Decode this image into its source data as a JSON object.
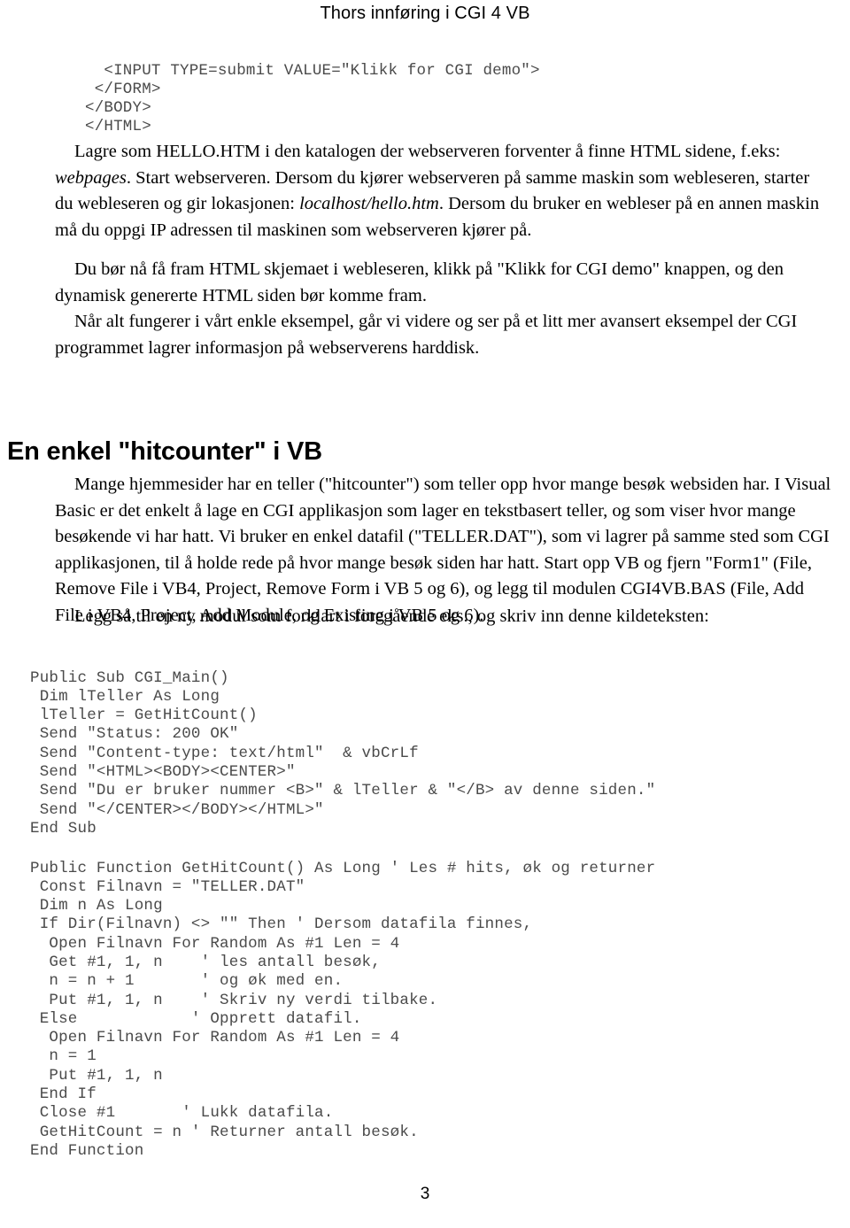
{
  "document": {
    "running_header": "Thors innføring i CGI 4 VB",
    "page_number": "3"
  },
  "code_top": "  <INPUT TYPE=submit VALUE=\"Klikk for CGI demo\">\n </FORM>\n</BODY>\n</HTML>",
  "paragraphs": {
    "p1_part1": "Lagre som HELLO.HTM i den katalogen der webserveren forventer å finne HTML  sidene, f.eks: ",
    "p1_italic1": "webpages",
    "p1_part2": ". Start webserveren. Dersom du kjører  webserveren på samme maskin som webleseren, starter du webleseren og  gir lokasjonen: ",
    "p1_italic2": "localhost/hello.htm",
    "p1_part3": ". Dersom du bruker en webleser  på en annen maskin må du oppgi IP adressen til maskinen som  webserveren kjører på.",
    "p2": "Du bør nå få fram HTML skjemaet i webleseren, klikk  på \"Klikk for CGI demo\" knappen, og den dynamisk genererte HTML siden bør komme fram.",
    "p3": "Når alt fungerer i vårt enkle eksempel, går vi videre  og ser på et litt mer avansert eksempel der CGI programmet lagrer  informasjon på webserverens harddisk.",
    "p4": "Mange hjemmesider har en teller (\"hitcounter\") som teller opp  hvor mange besøk websiden har. I Visual Basic er det enkelt å  lage en CGI applikasjon som lager en tekstbasert teller, og som viser hvor  mange besøkende vi har hatt. Vi bruker en enkel datafil  (\"TELLER.DAT\"), som vi lagrer på samme sted som CGI applikasjonen, til å holde rede på hvor mange besøk  siden har hatt. Start opp VB og fjern \"Form1\"  (File, Remove File i VB4, Project, Remove Form i VB 5 og 6), og legg til  modulen CGI4VB.BAS (File, Add File i VB4, Project, Add Module, og  Existing i VB 5 og 6).",
    "p5": "Legg så til en ny modul som forklart i foregående eks.,  og skriv inn denne kildeteksten:"
  },
  "section_heading": "En enkel \"hitcounter\" i VB",
  "code_main": "Public Sub CGI_Main()\n Dim lTeller As Long\n lTeller = GetHitCount()\n Send \"Status: 200 OK\"\n Send \"Content-type: text/html\"  & vbCrLf\n Send \"<HTML><BODY><CENTER>\"\n Send \"Du er bruker nummer <B>\" & lTeller & \"</B> av denne siden.\"\n Send \"</CENTER></BODY></HTML>\"\nEnd Sub",
  "code_func": "Public Function GetHitCount() As Long ' Les # hits, øk og returner\n Const Filnavn = \"TELLER.DAT\"\n Dim n As Long\n If Dir(Filnavn) <> \"\" Then ' Dersom datafila finnes,\n  Open Filnavn For Random As #1 Len = 4\n  Get #1, 1, n    ' les antall besøk,\n  n = n + 1       ' og øk med en.\n  Put #1, 1, n    ' Skriv ny verdi tilbake.\n Else            ' Opprett datafil.\n  Open Filnavn For Random As #1 Len = 4\n  n = 1\n  Put #1, 1, n\n End If\n Close #1       ' Lukk datafila.\n GetHitCount = n ' Returner antall besøk.\nEnd Function"
}
